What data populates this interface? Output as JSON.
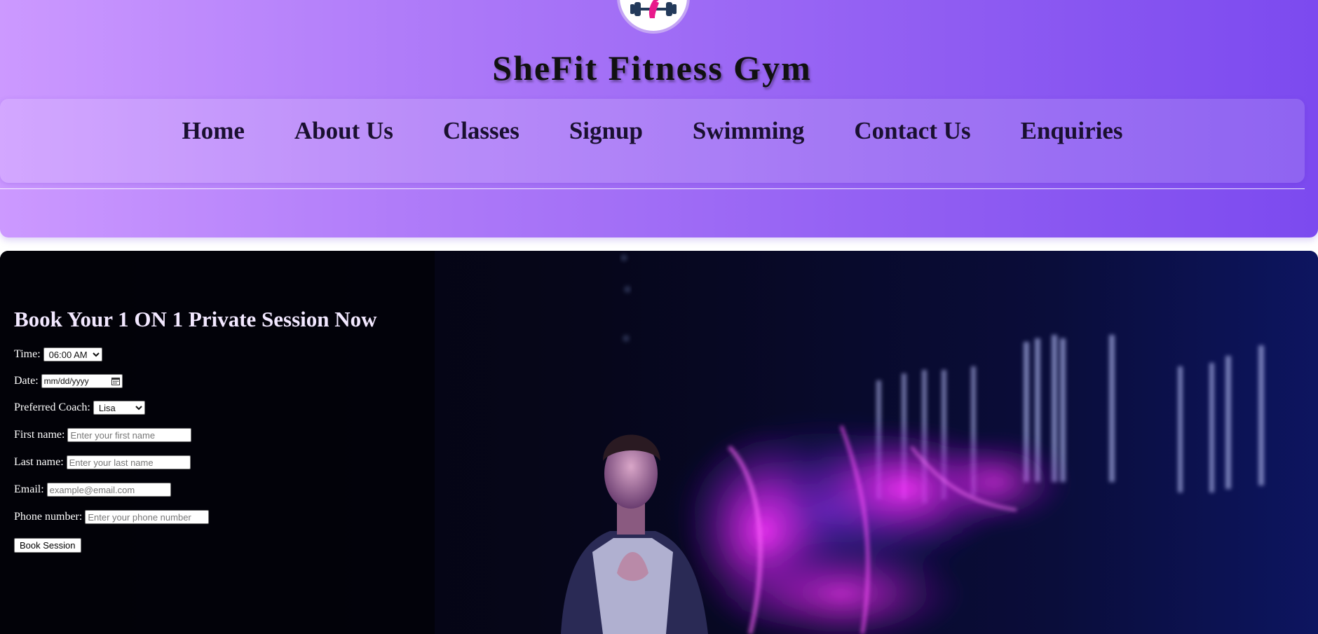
{
  "site": {
    "title": "SheFit Fitness Gym",
    "logo_icon": "dumbbell-woman-logo"
  },
  "nav": {
    "items": [
      {
        "label": "Home"
      },
      {
        "label": "About Us"
      },
      {
        "label": "Classes"
      },
      {
        "label": "Signup"
      },
      {
        "label": "Swimming"
      },
      {
        "label": "Contact Us"
      },
      {
        "label": "Enquiries"
      }
    ]
  },
  "booking": {
    "heading": "Book Your 1 ON 1 Private Session Now",
    "time": {
      "label": "Time:",
      "selected": "06:00 AM"
    },
    "date": {
      "label": "Date:",
      "placeholder": "mm/dd/yyyy"
    },
    "coach": {
      "label": "Preferred Coach:",
      "selected": "Lisa"
    },
    "first_name": {
      "label": "First name:",
      "placeholder": "Enter your first name"
    },
    "last_name": {
      "label": "Last name:",
      "placeholder": "Enter your last name"
    },
    "email": {
      "label": "Email:",
      "placeholder": "example@email.com"
    },
    "phone": {
      "label": "Phone number:",
      "placeholder": "Enter your phone number"
    },
    "submit_label": "Book Session"
  },
  "colors": {
    "header_gradient_start": "#cc99ff",
    "header_gradient_end": "#7c4aef",
    "hero_background": "#05050f",
    "accent_magenta": "#ff3dff"
  }
}
